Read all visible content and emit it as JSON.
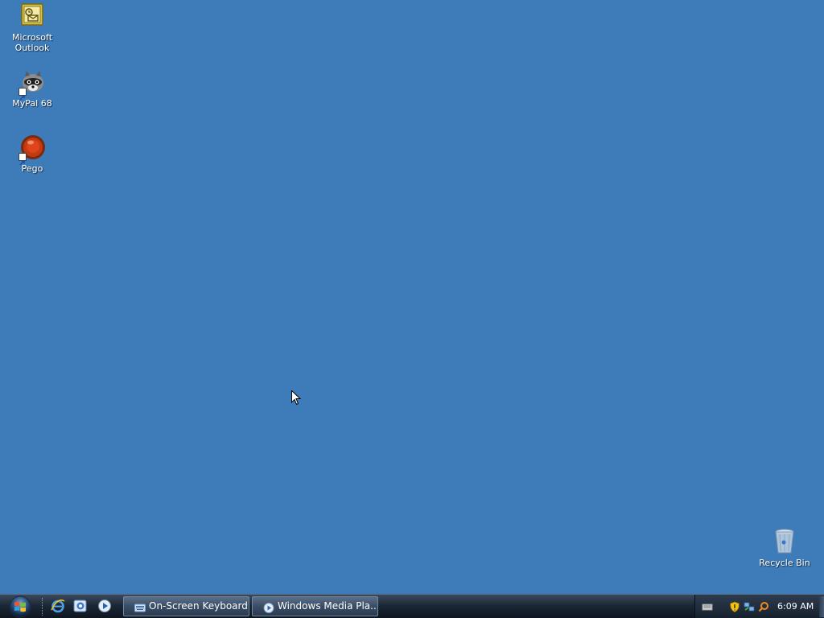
{
  "desktop": {
    "background_color": "#3e7bb9",
    "icons": [
      {
        "label": "Microsoft\nOutlook",
        "icon": "outlook-icon"
      },
      {
        "label": "MyPal 68",
        "icon": "mypal-raccoon-icon"
      },
      {
        "label": "Pego",
        "icon": "pego-orb-icon"
      },
      {
        "label": "Recycle Bin",
        "icon": "recycle-bin-icon"
      }
    ]
  },
  "taskbar": {
    "start_icon": "windows-start-orb",
    "quick_launch": [
      {
        "icon": "internet-explorer-icon"
      },
      {
        "icon": "app-launcher-icon"
      },
      {
        "icon": "media-player-icon"
      }
    ],
    "tasks": [
      {
        "label": "On-Screen Keyboard",
        "icon": "keyboard-icon"
      },
      {
        "label": "Windows Media Pla...",
        "icon": "windows-media-player-icon"
      }
    ],
    "tray": {
      "icons": [
        "keyboard-tray-icon",
        "security-shield-icon",
        "network-icon",
        "search-icon"
      ],
      "clock": "6:09 AM"
    }
  }
}
